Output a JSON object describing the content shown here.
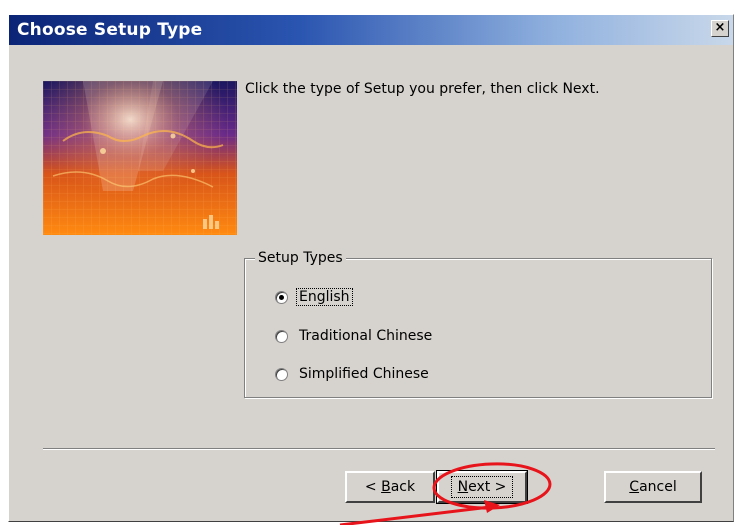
{
  "window": {
    "title": "Choose Setup Type",
    "close_glyph": "×"
  },
  "main": {
    "instruction": "Click the type of Setup you prefer, then click Next."
  },
  "setup_types": {
    "legend": "Setup Types",
    "options": [
      {
        "label": "English",
        "selected": true
      },
      {
        "label": "Traditional Chinese",
        "selected": false
      },
      {
        "label": "Simplified Chinese",
        "selected": false
      }
    ]
  },
  "buttons": {
    "back_prefix": "< ",
    "back_access": "B",
    "back_rest": "ack",
    "next_access": "N",
    "next_rest": "ext >",
    "cancel_access": "C",
    "cancel_rest": "ancel"
  },
  "colors": {
    "dialog_face": "#d6d3ce",
    "titlebar_start": "#0b2476",
    "annotation": "#e8141c"
  }
}
